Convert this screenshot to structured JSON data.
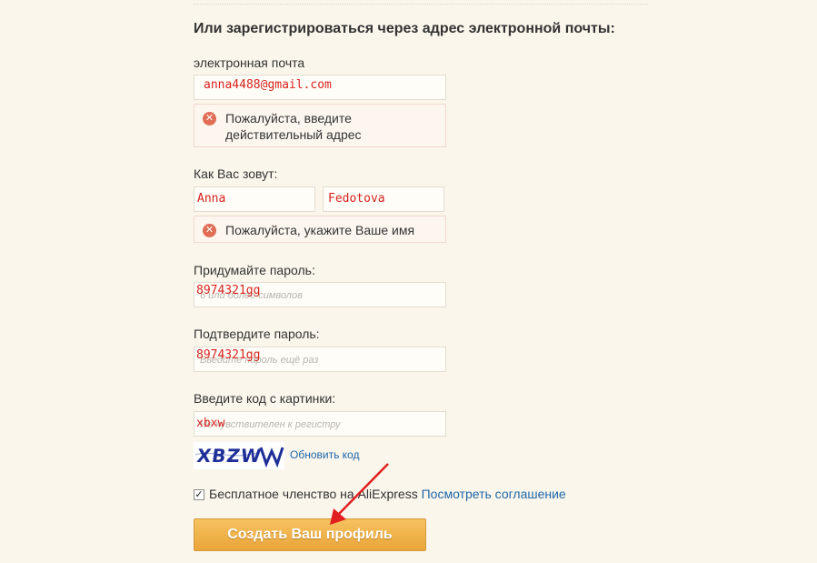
{
  "form": {
    "heading": "Или зарегистрироваться через адрес электронной почты:",
    "email": {
      "label": "электронная почта",
      "value": "anna4488@gmail.com",
      "error": "Пожалуйста, введите действительный адрес"
    },
    "name": {
      "label": "Как Вас зовут:",
      "first_value": "Anna",
      "last_value": "Fedotova",
      "error": "Пожалуйста, укажите Ваше имя"
    },
    "password": {
      "label": "Придумайте пароль:",
      "placeholder": "6 или более символов",
      "value": "8974321gg"
    },
    "confirm": {
      "label": "Подтвердите пароль:",
      "placeholder": "Введите пароль ещё раз",
      "value": "8974321gg"
    },
    "captcha": {
      "label": "Введите код с картинки:",
      "placeholder": "Не чувствителен к регистру",
      "value": "xbxw",
      "image_text": "XBZW",
      "refresh_label": "Обновить код"
    },
    "terms": {
      "checked": true,
      "text": "Бесплатное членство на AliExpress",
      "link": "Посмотреть соглашение"
    },
    "submit_label": "Создать Ваш профиль"
  },
  "colors": {
    "background": "#fbf6ec",
    "entered_text": "#d8231f",
    "link": "#1f66a8",
    "button": "#f0b24a",
    "error_icon": "#e06d54",
    "annotation_arrow": "#e02020"
  },
  "icons": {
    "error": "error-circle-x-icon",
    "checkbox": "checkmark-icon"
  }
}
